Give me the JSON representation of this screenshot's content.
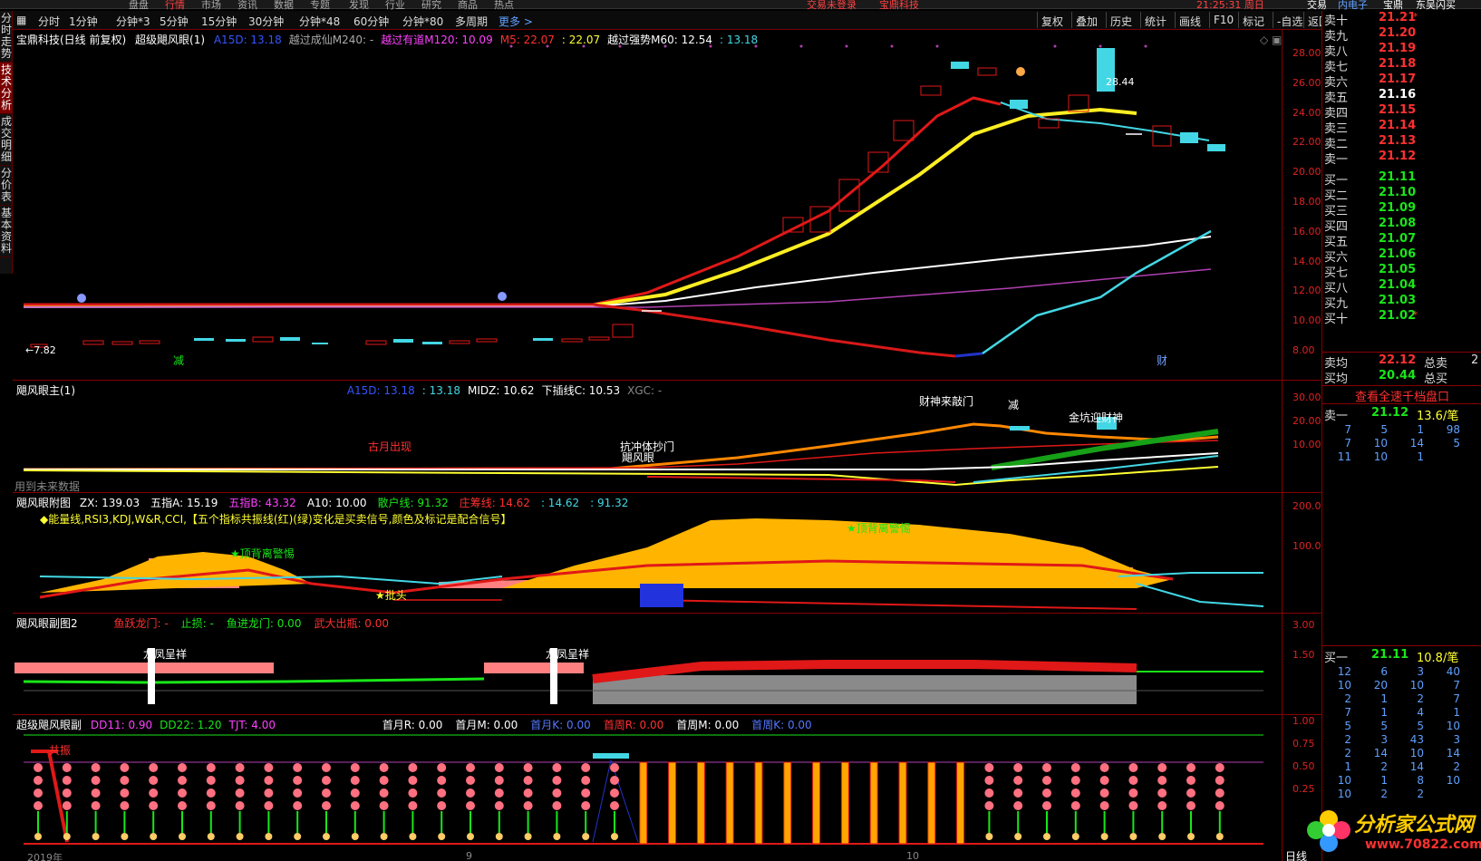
{
  "menubar": {
    "items": [
      "盘盘",
      "行情",
      "市场",
      "资讯",
      "数据",
      "专题",
      "发现",
      "行业",
      "研究",
      "商品",
      "热点"
    ],
    "center_left": "交易未登录",
    "center_right": "宝鼎科技",
    "time": "21:25:31 周日",
    "right_tabs": [
      "交易",
      "内电子",
      "宝鼎",
      "东吴闪买"
    ]
  },
  "left_tabs": [
    "分时走势",
    "技术分析",
    "成交明细",
    "分价表",
    "基本资料"
  ],
  "periods": [
    "分时",
    "1分钟",
    "分钟*3",
    "5分钟",
    "15分钟",
    "30分钟",
    "分钟*48",
    "60分钟",
    "分钟*80",
    "多周期",
    "更多 >"
  ],
  "toolbar_right": [
    "复权",
    "叠加",
    "历史",
    "统计",
    "画线",
    "F10",
    "标记",
    "-自选",
    "返回"
  ],
  "main_panel": {
    "stock": "宝鼎科技(日线 前复权)",
    "indicator": "超级飓风眼(1)",
    "params": [
      {
        "text": "A15D: 13.18",
        "color": "#3355ff"
      },
      {
        "text": "越过成仙M240: -",
        "color": "#aaaaaa"
      },
      {
        "text": "越过有道M120: 10.09",
        "color": "#ff40ff"
      },
      {
        "text": "M5: 22.07",
        "color": "#ff3030"
      },
      {
        "text": ": 22.07",
        "color": "#ffff33"
      },
      {
        "text": "越过强势M60: 12.54",
        "color": "#ffffff"
      },
      {
        "text": ": 13.18",
        "color": "#43d7e5"
      }
    ],
    "y_ticks": [
      "28.00",
      "26.00",
      "24.00",
      "22.00",
      "20.00",
      "18.00",
      "16.00",
      "14.00",
      "12.00",
      "10.00",
      "8.00"
    ],
    "high_label": "28.44",
    "low_label": "←7.82",
    "notes": [
      "减",
      "财"
    ]
  },
  "panel2": {
    "title": "飓风眼主(1)",
    "params": [
      {
        "text": "A15D: 13.18",
        "color": "#3355ff"
      },
      {
        "text": ": 13.18",
        "color": "#43d7e5"
      },
      {
        "text": "MIDZ: 10.62",
        "color": "#ffffff"
      },
      {
        "text": "下插线C: 10.53",
        "color": "#ffffff"
      },
      {
        "text": "XGC: -",
        "color": "#888888"
      }
    ],
    "y_ticks": [
      "30.00",
      "20.00",
      "10.00"
    ],
    "labels": [
      "财神来敲门",
      "减",
      "金坑迎财神",
      "古月出现",
      "抗冲体抄门",
      "飓风眼"
    ],
    "footnote": "用到未来数据"
  },
  "panel3": {
    "title": "飓风眼附图",
    "params": [
      {
        "text": "ZX: 139.03",
        "color": "#ffffff"
      },
      {
        "text": "五指A: 15.19",
        "color": "#ffffff"
      },
      {
        "text": "五指B: 43.32",
        "color": "#ff40ff"
      },
      {
        "text": "A10: 10.00",
        "color": "#ffffff"
      },
      {
        "text": "散户线: 91.32",
        "color": "#19e619"
      },
      {
        "text": "庄筹线: 14.62",
        "color": "#ff3030"
      },
      {
        "text": ": 14.62",
        "color": "#43d7e5"
      },
      {
        "text": ": 91.32",
        "color": "#43d7e5"
      }
    ],
    "hint": "◆能量线,RSI3,KDJ,W&R,CCI,【五个指标共振线(红)(绿)变化是买卖信号,颜色及标记是配合信号】",
    "y_ticks": [
      "200.0",
      "100.0"
    ],
    "labels": [
      "★顶背离警惕",
      "★顶背离警惕",
      "★批头"
    ]
  },
  "panel4": {
    "title": "飓风眼副图2",
    "params": [
      {
        "text": "鱼跃龙门: -",
        "color": "#ff3030"
      },
      {
        "text": "止损: -",
        "color": "#19e619"
      },
      {
        "text": "鱼进龙门: 0.00",
        "color": "#19e619"
      },
      {
        "text": "武大出瓶: 0.00",
        "color": "#ff3030"
      }
    ],
    "y_ticks": [
      "3.00",
      "1.50"
    ],
    "labels": [
      "龙凤呈祥",
      "龙凤呈祥"
    ]
  },
  "panel5": {
    "title": "超级飓风眼副",
    "params": [
      {
        "text": "DD11: 0.90",
        "color": "#ff40ff"
      },
      {
        "text": "DD22: 1.20",
        "color": "#19e619"
      },
      {
        "text": "TJT: 4.00",
        "color": "#ff40ff"
      }
    ],
    "params2": [
      {
        "text": "首月R: 0.00",
        "color": "#ffffff"
      },
      {
        "text": "首月M: 0.00",
        "color": "#ffffff"
      },
      {
        "text": "首月K: 0.00",
        "color": "#5577ff"
      },
      {
        "text": "首周R: 0.00",
        "color": "#ff3030"
      },
      {
        "text": "首周M: 0.00",
        "color": "#ffffff"
      },
      {
        "text": "首周K: 0.00",
        "color": "#5577ff"
      }
    ],
    "y_ticks": [
      "1.00",
      "0.75",
      "0.50",
      "0.25"
    ],
    "label": "共振",
    "x_labels": [
      "2019年",
      "9",
      "10"
    ],
    "axis_mode": "日线"
  },
  "order_book": {
    "asks": [
      {
        "label": "卖十",
        "price": "21.21",
        "mark": "*"
      },
      {
        "label": "卖九",
        "price": "21.20"
      },
      {
        "label": "卖八",
        "price": "21.19"
      },
      {
        "label": "卖七",
        "price": "21.18"
      },
      {
        "label": "卖六",
        "price": "21.17"
      },
      {
        "label": "卖五",
        "price": "21.16"
      },
      {
        "label": "卖四",
        "price": "21.15"
      },
      {
        "label": "卖三",
        "price": "21.14"
      },
      {
        "label": "卖二",
        "price": "21.13"
      },
      {
        "label": "卖一",
        "price": "21.12"
      }
    ],
    "bids": [
      {
        "label": "买一",
        "price": "21.11"
      },
      {
        "label": "买二",
        "price": "21.10"
      },
      {
        "label": "买三",
        "price": "21.09"
      },
      {
        "label": "买四",
        "price": "21.08"
      },
      {
        "label": "买五",
        "price": "21.07"
      },
      {
        "label": "买六",
        "price": "21.06"
      },
      {
        "label": "买七",
        "price": "21.05"
      },
      {
        "label": "买八",
        "price": "21.04"
      },
      {
        "label": "买九",
        "price": "21.03"
      },
      {
        "label": "买十",
        "price": "21.02",
        "mark": "*"
      }
    ],
    "avg_sell_label": "卖均",
    "avg_sell": "22.12",
    "total_sell_label": "总卖",
    "total_sell": "2",
    "avg_buy_label": "买均",
    "avg_buy": "20.44",
    "total_buy_label": "总买",
    "link": "查看全速千档盘口",
    "sell1_label": "卖一",
    "sell1_price": "21.12",
    "sell1_vol": "13.6/笔",
    "sell_queue": [
      [
        "7",
        "5",
        "1",
        "98"
      ],
      [
        "7",
        "10",
        "14",
        "5"
      ],
      [
        "11",
        "10",
        "1",
        ""
      ]
    ],
    "buy1_label": "买一",
    "buy1_price": "21.11",
    "buy1_vol": "10.8/笔",
    "buy_queue": [
      [
        "12",
        "6",
        "3",
        "40"
      ],
      [
        "10",
        "20",
        "10",
        "7"
      ],
      [
        "2",
        "1",
        "2",
        "7"
      ],
      [
        "7",
        "1",
        "4",
        "1"
      ],
      [
        "5",
        "5",
        "5",
        "10"
      ],
      [
        "2",
        "3",
        "43",
        "3"
      ],
      [
        "2",
        "14",
        "10",
        "14"
      ],
      [
        "1",
        "2",
        "14",
        "2"
      ],
      [
        "10",
        "1",
        "8",
        "10"
      ],
      [
        "10",
        "2",
        "2",
        ""
      ]
    ]
  },
  "logo": {
    "name": "分析家公式网",
    "url": "www.70822.com"
  }
}
